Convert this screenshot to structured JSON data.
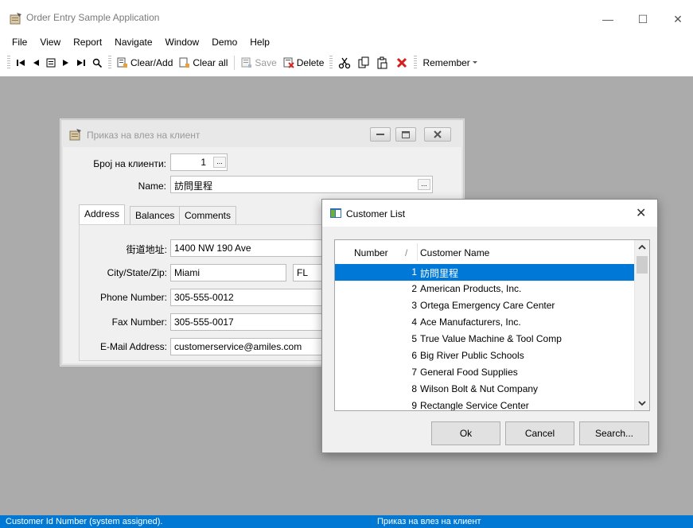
{
  "app": {
    "title": "Order Entry Sample Application",
    "window_controls": {
      "minimize": "—",
      "maximize": "☐",
      "close": "✕"
    }
  },
  "menu": [
    "File",
    "View",
    "Report",
    "Navigate",
    "Window",
    "Demo",
    "Help"
  ],
  "toolbar": {
    "first": "|◀",
    "prev": "◀",
    "list": "☰",
    "next": "▶",
    "last": "▶|",
    "find": "⌕",
    "clear_add": "Clear/Add",
    "clear_all": "Clear all",
    "save": "Save",
    "delete": "Delete",
    "remember": "Remember"
  },
  "child_window": {
    "title": "Приказ на влез на клиент",
    "customer_number_label": "Број на клиенти:",
    "customer_number_value": "1",
    "name_label": "Name:",
    "name_value": "訪問里程",
    "tabs": [
      "Address",
      "Balances",
      "Comments"
    ],
    "address": {
      "street_label": "街道地址:",
      "street_value": "1400 NW 190 Ave",
      "city_label": "City/State/Zip:",
      "city_value": "Miami",
      "state_value": "FL",
      "phone_label": "Phone Number:",
      "phone_value": "305-555-0012",
      "fax_label": "Fax Number:",
      "fax_value": "305-555-0017",
      "email_label": "E-Mail Address:",
      "email_value": "customerservice@amiles.com"
    }
  },
  "dialog": {
    "title": "Customer List",
    "columns": {
      "number": "Number",
      "name": "Customer Name",
      "sort_glyph": "/"
    },
    "rows": [
      {
        "number": "1",
        "name": "訪問里程"
      },
      {
        "number": "2",
        "name": "American Products, Inc."
      },
      {
        "number": "3",
        "name": "Ortega Emergency Care Center"
      },
      {
        "number": "4",
        "name": "Ace Manufacturers, Inc."
      },
      {
        "number": "5",
        "name": "True Value Machine & Tool Comp"
      },
      {
        "number": "6",
        "name": "Big River Public Schools"
      },
      {
        "number": "7",
        "name": "General Food Supplies"
      },
      {
        "number": "8",
        "name": "Wilson Bolt & Nut Company"
      },
      {
        "number": "9",
        "name": "Rectangle Service Center"
      }
    ],
    "buttons": {
      "ok": "Ok",
      "cancel": "Cancel",
      "search": "Search..."
    }
  },
  "status": {
    "left": "Customer Id Number (system assigned).",
    "right": "Приказ на влез на клиент"
  },
  "colors": {
    "workspace": "#ababab",
    "status_bar": "#0078d4",
    "selection": "#0078d7"
  }
}
